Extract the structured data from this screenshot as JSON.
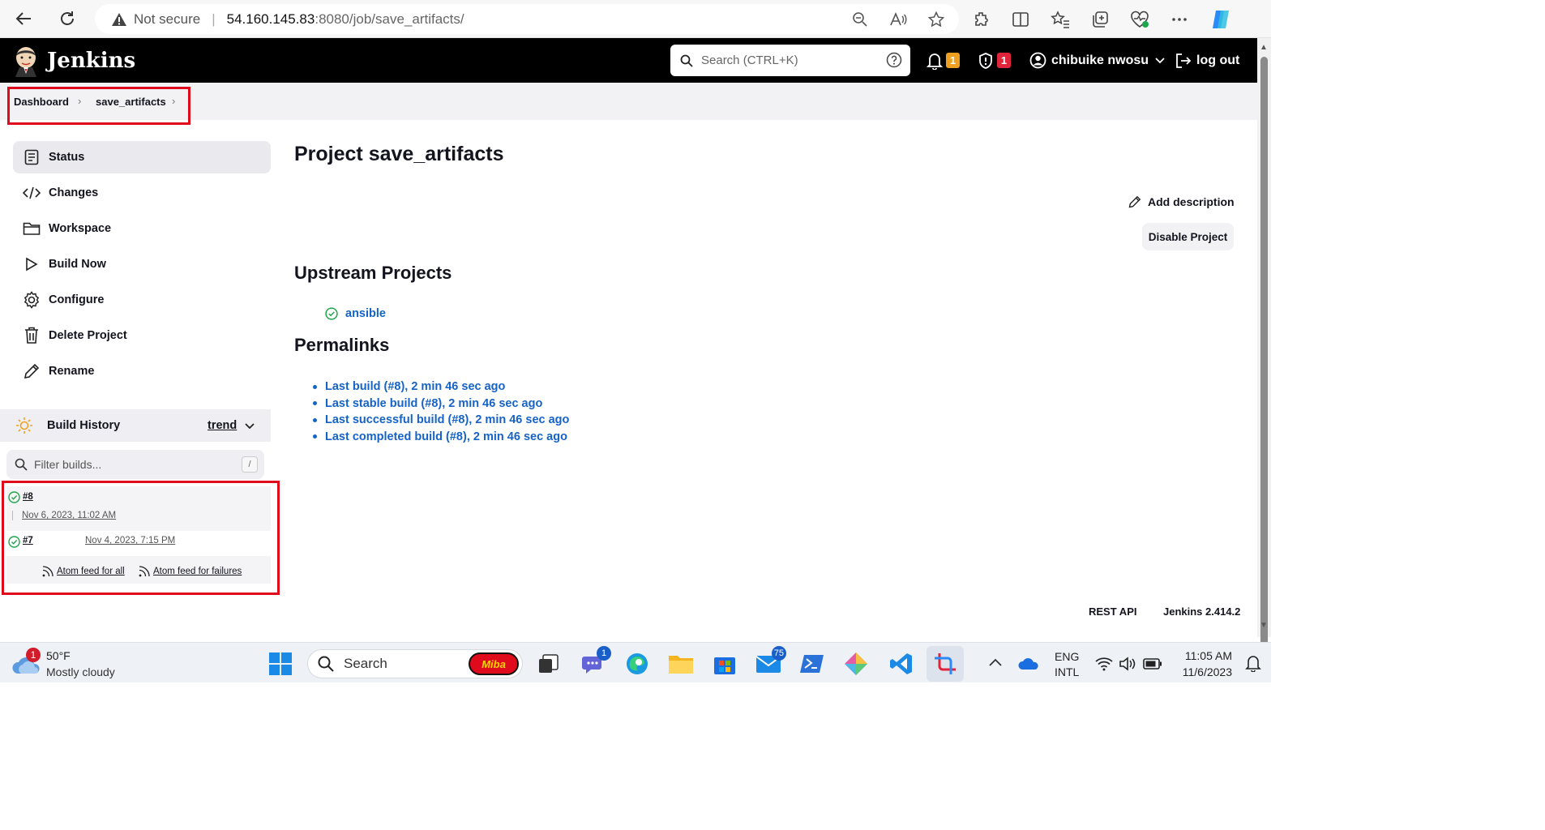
{
  "browser": {
    "not_secure": "Not secure",
    "url_host": "54.160.145.83",
    "url_path": ":8080/job/save_artifacts/"
  },
  "header": {
    "logo_title": "Jenkins",
    "search_placeholder": "Search (CTRL+K)",
    "notifications_count": "1",
    "security_count": "1",
    "user_name": "chibuike nwosu",
    "logout_label": "log out"
  },
  "breadcrumb": {
    "items": [
      {
        "label": "Dashboard"
      },
      {
        "label": "save_artifacts"
      }
    ]
  },
  "sidebar": {
    "tasks": [
      {
        "label": "Status",
        "icon": "status-icon"
      },
      {
        "label": "Changes",
        "icon": "code-icon"
      },
      {
        "label": "Workspace",
        "icon": "folder-icon"
      },
      {
        "label": "Build Now",
        "icon": "play-icon"
      },
      {
        "label": "Configure",
        "icon": "gear-icon"
      },
      {
        "label": "Delete Project",
        "icon": "trash-icon"
      },
      {
        "label": "Rename",
        "icon": "pencil-icon"
      }
    ],
    "build_history": {
      "title": "Build History",
      "trend_label": "trend",
      "filter_placeholder": "Filter builds...",
      "filter_shortcut": "/",
      "builds": [
        {
          "number": "#8",
          "date": "Nov 6, 2023, 11:02 AM"
        },
        {
          "number": "#7",
          "date": "Nov 4, 2023, 7:15 PM"
        }
      ],
      "feed_all": "Atom feed for all",
      "feed_failures": "Atom feed for failures"
    }
  },
  "main": {
    "title": "Project save_artifacts",
    "add_description": "Add description",
    "disable_project": "Disable Project",
    "upstream_title": "Upstream Projects",
    "upstream_projects": [
      "ansible"
    ],
    "permalinks_title": "Permalinks",
    "permalinks": [
      "Last build (#8), 2 min 46 sec ago",
      "Last stable build (#8), 2 min 46 sec ago",
      "Last successful build (#8), 2 min 46 sec ago",
      "Last completed build (#8), 2 min 46 sec ago"
    ]
  },
  "footer": {
    "rest_api": "REST API",
    "version": "Jenkins 2.414.2"
  },
  "taskbar": {
    "weather_temp": "50°F",
    "weather_desc": "Mostly cloudy",
    "weather_badge": "1",
    "search_label": "Search",
    "miba_label": "Miba",
    "teams_badge": "1",
    "mail_badge": "75",
    "lang_top": "ENG",
    "lang_bottom": "INTL",
    "time": "11:05 AM",
    "date": "11/6/2023"
  },
  "colors": {
    "link_blue": "#1663c7",
    "highlight_red": "#e00a1d",
    "success_green": "#1ea64b"
  }
}
